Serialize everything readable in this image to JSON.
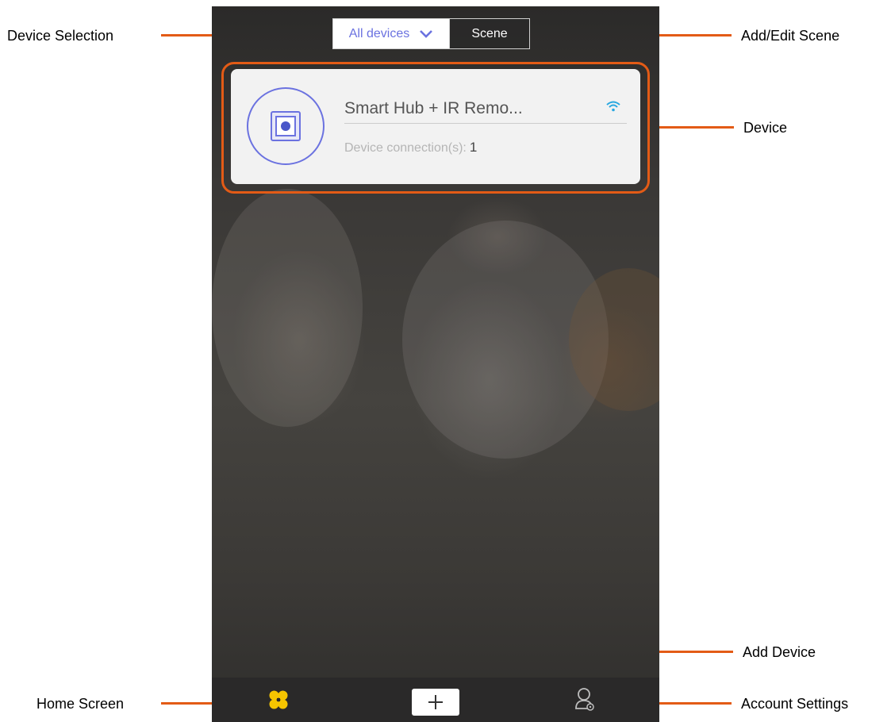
{
  "callouts": {
    "device_selection": "Device Selection",
    "add_edit_scene": "Add/Edit Scene",
    "device": "Device",
    "add_device": "Add Device",
    "home_screen": "Home Screen",
    "account_settings": "Account Settings"
  },
  "header": {
    "device_filter_label": "All devices",
    "device_filter_icon": "chevron-down-icon",
    "scene_label": "Scene"
  },
  "device_card": {
    "name": "Smart Hub + IR Remo...",
    "connection_label": "Device connection(s):",
    "connection_count": "1",
    "status_icon": "wifi-icon"
  },
  "bottom_bar": {
    "home_icon": "home-icon",
    "add_icon": "plus-icon",
    "account_icon": "account-icon"
  },
  "colors": {
    "accent": "#6b72e0",
    "callout": "#e35b16",
    "wifi": "#29a8e0",
    "home_icon": "#f5c400"
  }
}
